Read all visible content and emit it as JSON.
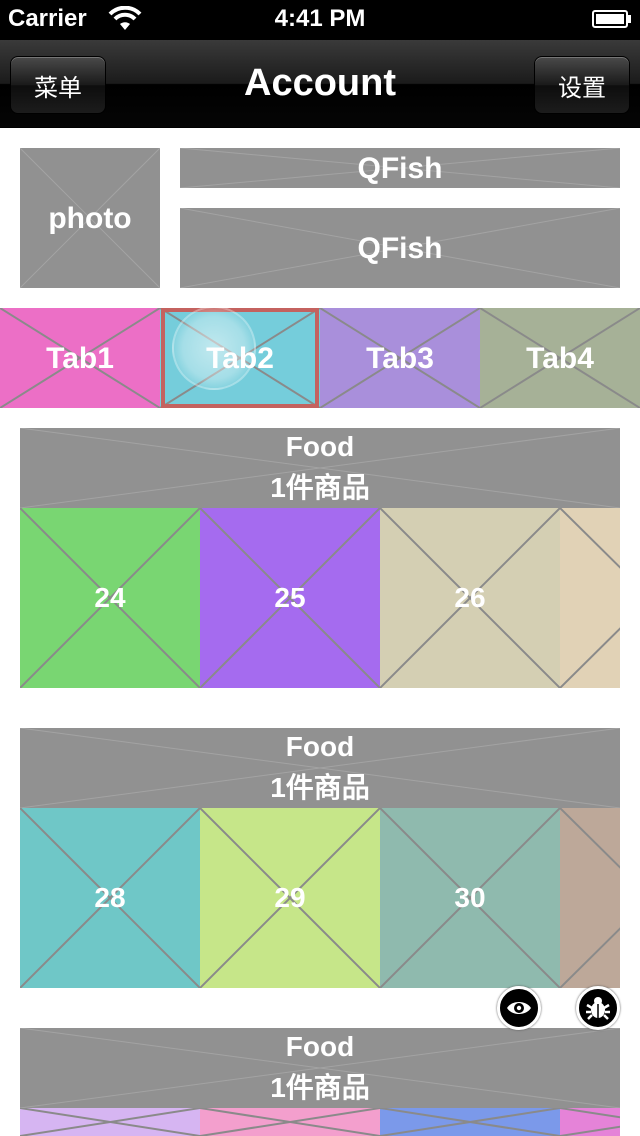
{
  "status_bar": {
    "carrier": "Carrier",
    "time": "4:41 PM"
  },
  "nav": {
    "title": "Account",
    "left_button": "菜单",
    "right_button": "设置"
  },
  "profile": {
    "photo_label": "photo",
    "name_line1": "QFish",
    "name_line2": "QFish"
  },
  "tabs": [
    {
      "label": "Tab1",
      "color": "#ec6fc6"
    },
    {
      "label": "Tab2",
      "color": "#75cddb",
      "selected": true
    },
    {
      "label": "Tab3",
      "color": "#a98fdb"
    },
    {
      "label": "Tab4",
      "color": "#a6b197"
    }
  ],
  "sections": [
    {
      "title": "Food",
      "subtitle": "1件商品",
      "tiles": [
        {
          "label": "24",
          "color": "#79d672"
        },
        {
          "label": "25",
          "color": "#a56bef"
        },
        {
          "label": "26",
          "color": "#d4cfb3"
        },
        {
          "label": "",
          "color": "#e1d2b6"
        }
      ]
    },
    {
      "title": "Food",
      "subtitle": "1件商品",
      "tiles": [
        {
          "label": "28",
          "color": "#6fc7c7"
        },
        {
          "label": "29",
          "color": "#c6e689"
        },
        {
          "label": "30",
          "color": "#8fbaae"
        },
        {
          "label": "",
          "color": "#bda899"
        }
      ]
    },
    {
      "title": "Food",
      "subtitle": "1件商品",
      "tiles": [
        {
          "label": "",
          "color": "#d6b5f2"
        },
        {
          "label": "",
          "color": "#f39fcd"
        },
        {
          "label": "",
          "color": "#7b99ea"
        },
        {
          "label": "",
          "color": "#e583d8"
        }
      ]
    }
  ],
  "debug_buttons": {
    "inspector": "eye-icon",
    "bug": "bug-icon"
  }
}
